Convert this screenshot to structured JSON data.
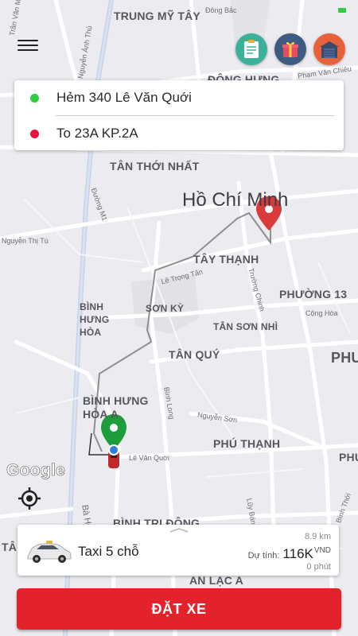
{
  "addresses": {
    "pickup": "Hẻm 340 Lê Văn Quới",
    "dropoff": "To 23A KP.2A"
  },
  "map": {
    "labels": {
      "trung_my_tay": "TRUNG MỸ TÂY",
      "dong_hung": "ĐÔNG HƯNG",
      "tan_thoi_nhat": "TÂN THỚI NHẤT",
      "ho_chi_minh": "Hồ Chí Minh",
      "duong_m1": "Đường M1",
      "nguyen_thi_tu": "Nguyễn Thị Tú",
      "tay_thanh": "TÂY THẠNH",
      "le_trong_tan": "Lê Trọng Tấn",
      "truong_chinh": "Trường Chinh",
      "phuong_13": "PHƯỜNG 13",
      "cong_hoa": "Cộng Hòa",
      "binh_hung_hoa": "BÌNH HƯNG HÒA",
      "son_ky": "SƠN KỲ",
      "tan_son_nhi": "TÂN SƠN NHÌ",
      "phu": "PHU",
      "tan_quy": "TÂN QUÝ",
      "binh_hung_hoa_a": "BÌNH HƯNG HÒA A",
      "nguyen_son": "Nguyễn Sơn",
      "binh_long": "Bình Long",
      "phu_thanh": "PHÚ THẠNH",
      "le_van_quoi": "Lê Văn Quới",
      "phu_right": "PHU",
      "luy_ban_bich": "Lũy Bán Bích",
      "ba_hom": "Bà Hom",
      "binh_tri_dong": "BÌNH TRỊ ĐÔNG",
      "an_lac_a": "AN LẠC A",
      "binh_thoi": "Bình Thới",
      "tran_van_muoi": "Trần Văn Mười",
      "nguyen_anh_thu": "Nguyễn Ảnh Thủ",
      "dong_bac": "Đông Bắc",
      "pham_van_chieu": "Phạm Văn Chiêu",
      "ta_left": "TÂ"
    },
    "google_logo": "Google"
  },
  "vehicle": {
    "name": "Taxi 5 chỗ",
    "distance": "8.9 km",
    "price_label": "Dự tính:",
    "price": "116K",
    "currency": "VND",
    "duration": "0 phút"
  },
  "book_button": "ĐẶT XE",
  "icon_colors": {
    "note": "#3bb09a",
    "gift": "#3d5a80",
    "garage": "#e8613a",
    "pickup_dot": "#2ecc40",
    "dropoff_dot": "#e8143a",
    "accent_red": "#e3222c"
  }
}
